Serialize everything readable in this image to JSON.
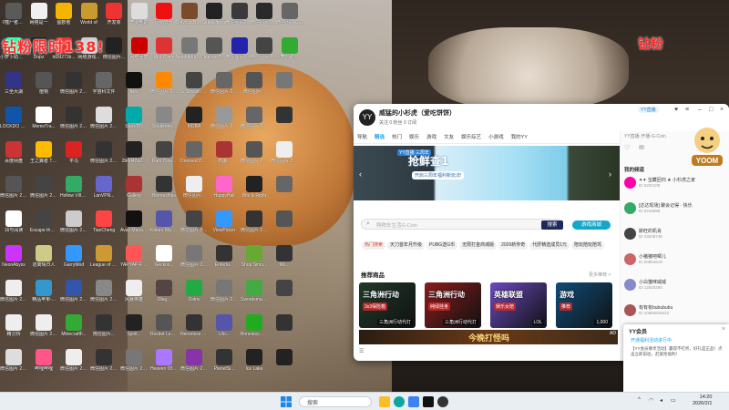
{
  "desktop": {
    "promo_left": "钻粉限时138!",
    "promo_right": "钻粉",
    "icons": [
      {
        "label": "《噬尸者》出现",
        "color": "#5a5a5a"
      },
      {
        "label": "网络是一",
        "color": "#f0f0f0"
      },
      {
        "label": "图欧者",
        "color": "#f4b400"
      },
      {
        "label": "World of",
        "color": "#c99a2e"
      },
      {
        "label": "开发商",
        "color": "#e33"
      },
      {
        "label": "开源部的",
        "color": "#ddd"
      },
      {
        "label": "网易云音",
        "color": "#e11"
      },
      {
        "label": "Only Up BRAIN...",
        "color": "#7b4a2b"
      },
      {
        "label": "Side Effects",
        "color": "#222"
      },
      {
        "label": "微信图片202601...",
        "color": "#3a3a3a"
      },
      {
        "label": "微信图片2026...",
        "color": "#2a2a2a"
      },
      {
        "label": "微信图JPG 2",
        "color": "#666"
      },
      {
        "label": "小萝卜助手(v1...",
        "color": "#2fa"
      },
      {
        "label": "Dopz",
        "color": "#1a1a1a"
      },
      {
        "label": "td2d271b...",
        "color": "#e33"
      },
      {
        "label": "网络游戏...",
        "color": "#d0d0d0"
      },
      {
        "label": "微信图片...",
        "color": "#222"
      },
      {
        "label": "网络回复",
        "color": "#c00"
      },
      {
        "label": "Riot Client",
        "color": "#d33"
      },
      {
        "label": "Neighbours back From",
        "color": "#777"
      },
      {
        "label": "Chained Together",
        "color": "#555"
      },
      {
        "label": "微信图片 2025110...",
        "color": "#22a"
      },
      {
        "label": "微信图片 2026-01...",
        "color": "#444"
      },
      {
        "label": "小萝卜助手(Cross...",
        "color": "#3a3"
      },
      {
        "label": "三坐大湖",
        "color": "#338"
      },
      {
        "label": "植物",
        "color": "#555"
      },
      {
        "label": "微信图片 2025-08...",
        "color": "#333"
      },
      {
        "label": "宇宙科文件",
        "color": "#666"
      },
      {
        "label": "相片",
        "color": "#111"
      },
      {
        "label": "微信图片 20251102...",
        "color": "#f80"
      },
      {
        "label": "Si Stream Boston",
        "color": "#444"
      },
      {
        "label": "微信图片 20251102...",
        "color": "#666"
      },
      {
        "label": "微信图片...",
        "color": "#555"
      },
      {
        "label": "",
        "color": "#777"
      },
      {
        "label": "LOCKDO Protocol",
        "color": "#15a"
      },
      {
        "label": "MemoTra...",
        "color": "#fff"
      },
      {
        "label": "微信图片 20250...",
        "color": "#333"
      },
      {
        "label": "微信图片 20250...",
        "color": "#ddd"
      },
      {
        "label": "StarVPN",
        "color": "#0aa"
      },
      {
        "label": "Soulstone...",
        "color": "#888"
      },
      {
        "label": "MOBA",
        "color": "#222"
      },
      {
        "label": "微信图片 2026...",
        "color": "#999"
      },
      {
        "label": "微信图片 202506...",
        "color": "#666"
      },
      {
        "label": "",
        "color": "#333"
      },
      {
        "label": "百度网盘",
        "color": "#c33"
      },
      {
        "label": "王之翼者 The King",
        "color": "#fb0"
      },
      {
        "label": "平马",
        "color": "#d22"
      },
      {
        "label": "微信图片 2025091...",
        "color": "#333"
      },
      {
        "label": "2b0d42a2...",
        "color": "#222"
      },
      {
        "label": "Dark Cine...",
        "color": "#444"
      },
      {
        "label": "Dressed Zero",
        "color": "#666"
      },
      {
        "label": "高爆...",
        "color": "#a33"
      },
      {
        "label": "微信图片 20250...",
        "color": "#555"
      },
      {
        "label": "微信图片 2026...",
        "color": "#eee"
      },
      {
        "label": "微信图片 2025070...",
        "color": "#555"
      },
      {
        "label": "微信图片 2025073...",
        "color": "#444"
      },
      {
        "label": "Hollow Village",
        "color": "#3a6"
      },
      {
        "label": "LanVPN...",
        "color": "#66c"
      },
      {
        "label": "Gallery",
        "color": "#a33"
      },
      {
        "label": "Biomes/tips",
        "color": "#333"
      },
      {
        "label": "微信图片...",
        "color": "#eee"
      },
      {
        "label": "HappyHall",
        "color": "#f6c"
      },
      {
        "label": "Bits & Right",
        "color": "#222"
      },
      {
        "label": "",
        "color": "#666"
      },
      {
        "label": "16号阅读",
        "color": "#fff"
      },
      {
        "label": "Escape the Backrooms",
        "color": "#444"
      },
      {
        "label": "微信图片 2025101...",
        "color": "#ccc"
      },
      {
        "label": "TianCheng",
        "color": "#f44"
      },
      {
        "label": "Avas Manager",
        "color": "#111"
      },
      {
        "label": "Kibaro Mansion",
        "color": "#55a"
      },
      {
        "label": "微信图片 Bridge Re...",
        "color": "#444"
      },
      {
        "label": "ViewPicker",
        "color": "#39f"
      },
      {
        "label": "微信图片 2025112...",
        "color": "#333"
      },
      {
        "label": "",
        "color": "#555"
      },
      {
        "label": "NeonAbyss",
        "color": "#c3f"
      },
      {
        "label": "逃离晴日人",
        "color": "#cc8"
      },
      {
        "label": "GarryMod",
        "color": "#39f"
      },
      {
        "label": "League of Legends",
        "color": "#c93"
      },
      {
        "label": "YAPYAP-Fre...",
        "color": "#f55"
      },
      {
        "label": "Geckos...",
        "color": "#fff"
      },
      {
        "label": "微信图片 20250...",
        "color": "#777"
      },
      {
        "label": "Enterta...",
        "color": "#333"
      },
      {
        "label": "Shop Simu...",
        "color": "#6a3"
      },
      {
        "label": "Mo...",
        "color": "#333"
      },
      {
        "label": "微信图片 2025091...",
        "color": "#eee"
      },
      {
        "label": "精品苹果-...",
        "color": "#39c"
      },
      {
        "label": "微信图片 2025011...",
        "color": "#35a"
      },
      {
        "label": "微信图片 2025011...",
        "color": "#888"
      },
      {
        "label": "风暴英雄",
        "color": "#eee"
      },
      {
        "label": "Oleg...",
        "color": "#544"
      },
      {
        "label": "Ostriv",
        "color": "#2a4"
      },
      {
        "label": "微信图片 2025...",
        "color": "#777"
      },
      {
        "label": "Swordsman Crave",
        "color": "#4a4"
      },
      {
        "label": "",
        "color": "#444"
      },
      {
        "label": "精灵桥",
        "color": "#eee"
      },
      {
        "label": "微信图片 2025...",
        "color": "#eee"
      },
      {
        "label": "MinecraftF...",
        "color": "#3a3"
      },
      {
        "label": "微信图片...",
        "color": "#333"
      },
      {
        "label": "Spirit...",
        "color": "#222"
      },
      {
        "label": "Rocket League",
        "color": "#555"
      },
      {
        "label": "Nerveless Centre",
        "color": "#333"
      },
      {
        "label": "Ulo...",
        "color": "#55a"
      },
      {
        "label": "Boneless Fishing",
        "color": "#2a2"
      },
      {
        "label": "",
        "color": "#333"
      },
      {
        "label": "微信图片 2025...",
        "color": "#ddd"
      },
      {
        "label": "哔哩哔哩",
        "color": "#f58"
      },
      {
        "label": "微信图片 2025...",
        "color": "#eee"
      },
      {
        "label": "微信图片 2025...",
        "color": "#333"
      },
      {
        "label": "微信图片 2025...",
        "color": "#777"
      },
      {
        "label": "Heaven Of Canyon",
        "color": "#a7f"
      },
      {
        "label": "微信图片 2026...",
        "color": "#83a"
      },
      {
        "label": "PlanetSi...",
        "color": "#333"
      },
      {
        "label": "Ice Lake",
        "color": "#222"
      },
      {
        "label": "",
        "color": "#222"
      }
    ]
  },
  "yy": {
    "logo": "YY",
    "user_name": "威猛的小杉虎（爱吃饼饼）",
    "user_sub": "关注 0  粉丝 0  订阅",
    "badge": "YY直播",
    "nav": [
      "导航",
      "精选",
      "热门",
      "娱乐",
      "游戏",
      "文友",
      "娱乐综艺",
      "小游戏",
      "我的YY"
    ],
    "nav_active": 1,
    "banner_tag": "YY直播 三周年",
    "banner_title": "抢鲜查1",
    "banner_sub": "开启三周年福利新玩法!",
    "search_placeholder": "购物车生活G-Coin",
    "search_btn": "搜索",
    "gold_btn": "游戏商城",
    "tags": [
      "热门搜索",
      "天刀首年月升级",
      "PUBG送G币",
      "无限打金商城版",
      "2026新传奇",
      "代肝精选成员1元",
      "陪玩陪玩陪驾"
    ],
    "section_title": "推荐商品",
    "section_more": "更多推荐 >",
    "cards": [
      {
        "title": "三角洲行动",
        "sub": "3x3保险箱",
        "badge": "三角洲行动代打",
        "color": "#1f3a2a"
      },
      {
        "title": "三角洲行动",
        "sub": "纯绿挂身",
        "badge": "三角洲行动代打",
        "color": "#8a1c1c"
      },
      {
        "title": "英雄联盟",
        "sub": "娱乐女陪",
        "badge": "LOL",
        "color": "#6a4ac0"
      },
      {
        "title": "游戏",
        "sub": "推荐",
        "badge": "1,000",
        "color": "#0e4d7a"
      }
    ],
    "ad_title": "今晚打怪吗",
    "ad_label": "AD",
    "right": {
      "head": "YY直播·开播·G-Coin",
      "sec1": "我的频道",
      "sec2": "我的频道",
      "sec3": "我的频道",
      "items": [
        {
          "name": "✦✦ 宝藏回归 ★ 小杉虎之家",
          "id": "ID 5202108"
        },
        {
          "name": "[达达现场] 聚会记得 · 快乐",
          "id": "ID 6218698"
        },
        {
          "name": "斯旺的机肖",
          "id": "ID 43539748"
        },
        {
          "name": "小猪猪吧唧儿",
          "id": "ID 50954519"
        },
        {
          "name": "小白猫咪威威",
          "id": "ID 12820290"
        },
        {
          "name": "有有有bubububu",
          "id": "ID 10684818422"
        }
      ]
    },
    "notify": {
      "title": "YY会员",
      "link": "开通福利活动进行中",
      "body": "【YY会员尊享活动】赢得不打折，好礼是正品！点击立即前往，赶紧抢福利！"
    }
  },
  "taskbar": {
    "search": "搜索",
    "time": "14:20",
    "date": "2026/2/1"
  }
}
